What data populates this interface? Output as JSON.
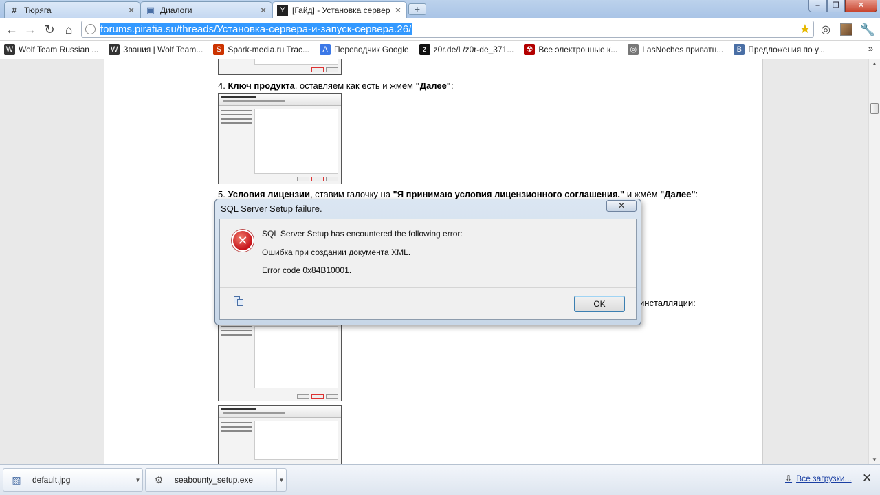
{
  "browser": {
    "tabs": [
      {
        "label": "Тюряга",
        "icon": "#"
      },
      {
        "label": "Диалоги",
        "icon": "▣"
      },
      {
        "label": "[Гайд] - Установка сервера",
        "icon": "Y"
      }
    ],
    "url": "forums.piratia.su/threads/Установка-сервера-и-запуск-сервера.26/",
    "bookmarks": [
      {
        "label": "Wolf Team Russian ...",
        "icon": "W",
        "color": "#333333"
      },
      {
        "label": "Звания | Wolf Team...",
        "icon": "W",
        "color": "#333333"
      },
      {
        "label": "Spark-media.ru Trac...",
        "icon": "S",
        "color": "#cc3300"
      },
      {
        "label": "Переводчик Google",
        "icon": "A",
        "color": "#3b78e7"
      },
      {
        "label": "z0r.de/L/z0r-de_371...",
        "icon": "z",
        "color": "#111111"
      },
      {
        "label": "Все электронные к...",
        "icon": "☢",
        "color": "#b30000"
      },
      {
        "label": "LasNoches приватн...",
        "icon": "◎",
        "color": "#777777"
      },
      {
        "label": "Предложения по у...",
        "icon": "B",
        "color": "#4a6fa5"
      }
    ],
    "more_glyph": "»"
  },
  "page": {
    "step4": {
      "num": "4.",
      "title": "Ключ продукта",
      "rest": ", оставляем как есть и жмём ",
      "action": "\"Далее\"",
      "end": ":"
    },
    "step5": {
      "num": "5.",
      "title": "Условия лицензии",
      "rest": ", ставим галочку на ",
      "checkbox": "\"Я принимаю условия лицензионного соглашения.\"",
      "rest2": " и жмём ",
      "action": "\"Далее\"",
      "end": ":"
    },
    "step6_tail": "инсталляции:"
  },
  "dialog": {
    "title": "SQL Server Setup failure.",
    "close_glyph": "✕",
    "line1": "SQL Server Setup has encountered the following error:",
    "line2": "Ошибка при создании документа XML.",
    "line3": "Error code 0x84B10001.",
    "ok_label": "OK",
    "error_glyph": "✕"
  },
  "downloads": {
    "items": [
      {
        "name": "default.jpg",
        "icon": "▨"
      },
      {
        "name": "seabounty_setup.exe",
        "icon": "⚙"
      }
    ],
    "show_all": "Все загрузки...",
    "close_glyph": "✕"
  }
}
